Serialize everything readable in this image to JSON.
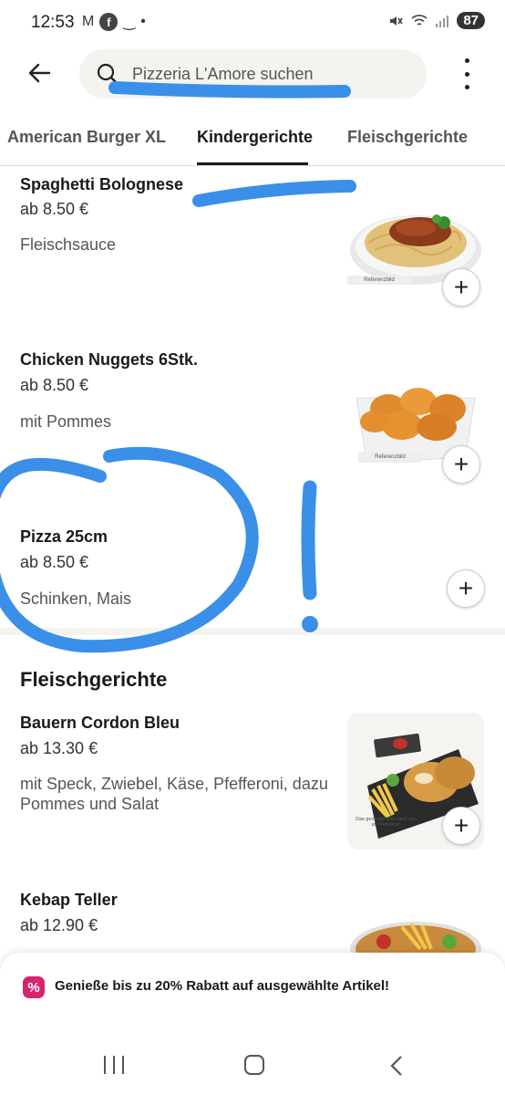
{
  "status_bar": {
    "time": "12:53",
    "battery": "87",
    "icons": [
      "gmail-icon",
      "facebook-icon",
      "amazon-icon",
      "dot-icon",
      "mute-icon",
      "wifi-icon",
      "signal-icon",
      "battery-icon"
    ]
  },
  "header": {
    "search_placeholder": "Pizzeria L'Amore suchen"
  },
  "tabs": [
    {
      "label": "American Burger XL",
      "active": false
    },
    {
      "label": "Kindergerichte",
      "active": true
    },
    {
      "label": "Fleischgerichte",
      "active": false
    }
  ],
  "kindergerichte": [
    {
      "name": "Spaghetti Bolognese",
      "price": "ab 8.50 €",
      "description": "Fleischsauce",
      "image": "spaghetti-photo",
      "image_label": "Referenzbild"
    },
    {
      "name": "Chicken Nuggets 6Stk.",
      "price": "ab 8.50 €",
      "description": "mit Pommes",
      "image": "nuggets-photo",
      "image_label": "Referenzbild"
    },
    {
      "name": "Pizza 25cm",
      "price": "ab 8.50 €",
      "description": "Schinken, Mais"
    }
  ],
  "fleischgerichte": {
    "title": "Fleischgerichte",
    "items": [
      {
        "name": "Bauern Cordon Bleu",
        "price": "ab 13.30 €",
        "description": "mit Speck, Zwiebel, Käse, Pfefferoni, dazu Pommes und Salat",
        "image": "cordon-bleu-photo",
        "image_label": "Das gezeigte Bild dient nur als Referenz"
      },
      {
        "name": "Kebap Teller",
        "price": "ab 12.90 €",
        "image": "kebap-photo"
      }
    ]
  },
  "promo": {
    "text": "Genieße bis zu 20% Rabatt auf ausgewählte Artikel!",
    "icon": "%"
  },
  "colors": {
    "annotation_blue": "#3a8fe8",
    "promo_pink": "#d6246e",
    "search_bg": "#f4f3ef"
  }
}
